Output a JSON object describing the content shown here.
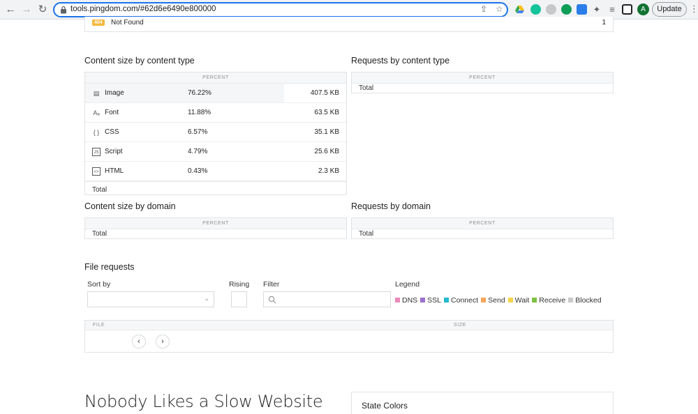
{
  "browser": {
    "url": "tools.pingdom.com/#62d6e6490e800000",
    "avatar_letter": "A",
    "update_label": "Update"
  },
  "status_row": {
    "badge": "404",
    "text": "Not Found",
    "count": "1"
  },
  "content_size_by_type": {
    "title": "Content size by content type",
    "col_percent": "PERCENT",
    "rows": [
      {
        "icon": "image-icon",
        "name": "Image",
        "percent": "76.22%",
        "size": "407.5 KB"
      },
      {
        "icon": "font-icon",
        "name": "Font",
        "percent": "11.88%",
        "size": "63.5 KB"
      },
      {
        "icon": "css-icon",
        "name": "CSS",
        "percent": "6.57%",
        "size": "35.1 KB"
      },
      {
        "icon": "script-icon",
        "name": "Script",
        "percent": "4.79%",
        "size": "25.6 KB"
      },
      {
        "icon": "html-icon",
        "name": "HTML",
        "percent": "0.43%",
        "size": "2.3 KB"
      }
    ],
    "total_label": "Total"
  },
  "requests_by_type": {
    "title": "Requests by content type",
    "col_percent": "PERCENT",
    "total_label": "Total"
  },
  "content_size_by_domain": {
    "title": "Content size by domain",
    "col_percent": "PERCENT",
    "total_label": "Total"
  },
  "requests_by_domain": {
    "title": "Requests by domain",
    "col_percent": "PERCENT",
    "total_label": "Total"
  },
  "file_requests": {
    "title": "File requests",
    "sort_by_label": "Sort by",
    "rising_label": "Rising",
    "filter_label": "Filter",
    "legend_label": "Legend",
    "legend": [
      {
        "name": "DNS",
        "color": "#e88bb7"
      },
      {
        "name": "SSL",
        "color": "#9b6fcf"
      },
      {
        "name": "Connect",
        "color": "#25b8d0"
      },
      {
        "name": "Send",
        "color": "#f5a65b"
      },
      {
        "name": "Wait",
        "color": "#f6d44a"
      },
      {
        "name": "Receive",
        "color": "#7cc242"
      },
      {
        "name": "Blocked",
        "color": "#c9c9c9"
      }
    ],
    "col_file": "FILE",
    "col_size": "SIZE"
  },
  "footer": {
    "headline": "Nobody Likes a Slow Website",
    "state_colors_title": "State Colors"
  }
}
